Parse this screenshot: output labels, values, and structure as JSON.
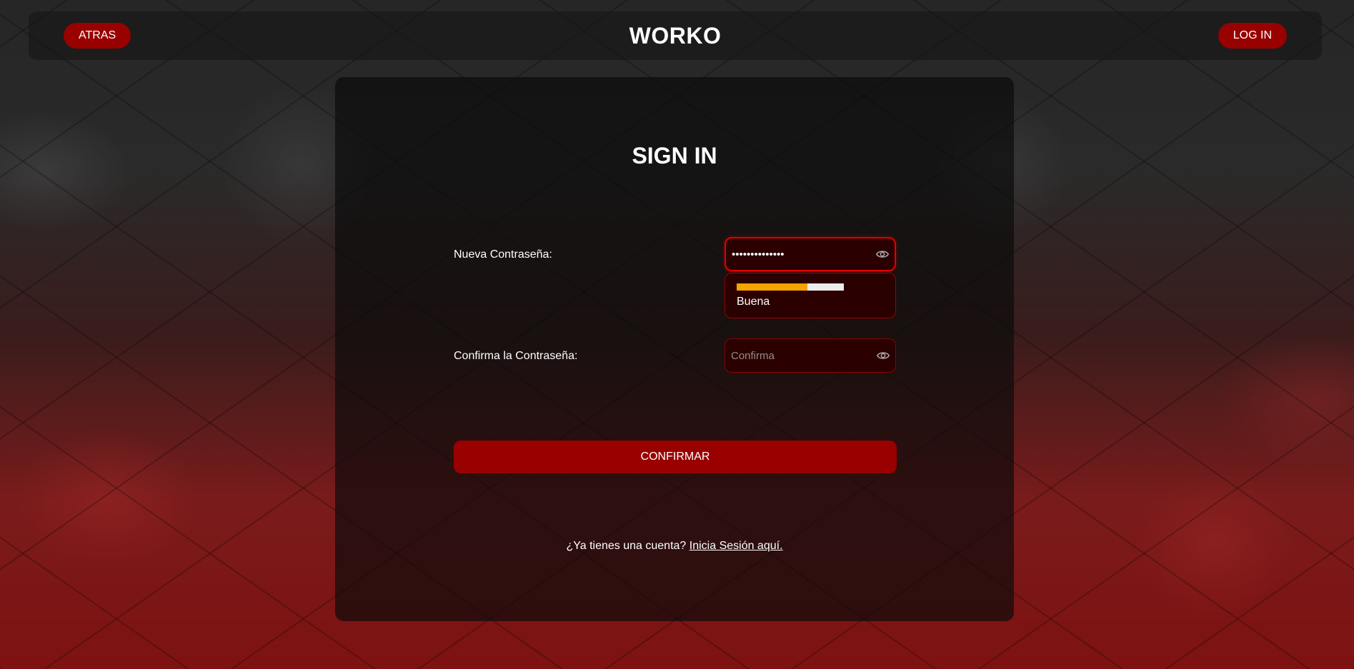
{
  "header": {
    "back_label": "ATRAS",
    "brand": "WORKO",
    "login_label": "LOG IN"
  },
  "form": {
    "title": "SIGN IN",
    "new_password": {
      "label": "Nueva Contraseña:",
      "value": "••••••••••••••",
      "icon": "eye-icon"
    },
    "strength": {
      "level": 0.66,
      "label": "Buena",
      "fill_color": "#f4a300"
    },
    "confirm_password": {
      "label": "Confirma la Contraseña:",
      "placeholder": "Confirma",
      "value": "",
      "icon": "eye-icon"
    },
    "submit_label": "CONFIRMAR"
  },
  "footer": {
    "prompt": "¿Ya tienes una cuenta?",
    "link_label": "Inicia Sesión aquí."
  },
  "colors": {
    "accent": "#990000",
    "field_bg": "#2a0000",
    "focus_border": "#e00000"
  }
}
